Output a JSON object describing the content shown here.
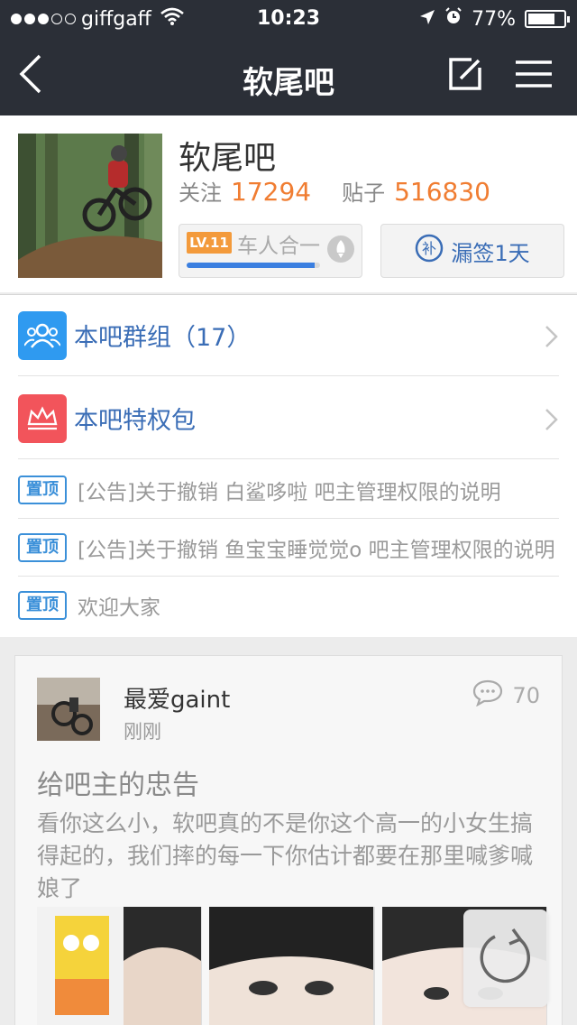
{
  "status_bar": {
    "carrier": "giffgaff",
    "time": "10:23",
    "battery": "77%",
    "battery_level": 0.77,
    "signal_bars_filled": 3,
    "signal_bars_total": 5
  },
  "nav": {
    "title": "软尾吧",
    "back_icon": "chevron-left-icon",
    "compose_icon": "compose-icon",
    "menu_icon": "hamburger-menu-icon"
  },
  "forum": {
    "name": "软尾吧",
    "follow_label": "关注",
    "follow_count": "17294",
    "posts_label": "贴子",
    "posts_count": "516830",
    "level_badge": "LV.11",
    "level_name": "车人合一",
    "level_progress": 0.96,
    "sign_button": "漏签1天",
    "sign_icon_text": "补"
  },
  "entries": [
    {
      "label": "本吧群组（17）",
      "icon": "group-icon",
      "color": "#2f9af0"
    },
    {
      "label": "本吧特权包",
      "icon": "crown-icon",
      "color": "#f2545b"
    }
  ],
  "pinned_tag": "置顶",
  "notices": [
    "[公告]关于撤销 白鲨哆啦 吧主管理权限的说明",
    "[公告]关于撤销 鱼宝宝睡觉觉o  吧主管理权限的说明",
    "欢迎大家"
  ],
  "post": {
    "author": "最爱gaint",
    "time": "刚刚",
    "reply_count": "70",
    "title": "给吧主的忠告",
    "body": "看你这么小，软吧真的不是你这个高一的小女生搞得起的，我们摔的每一下你估计都要在那里喊爹喊娘了"
  },
  "colors": {
    "nav_bg": "#2b2f37",
    "accent_orange": "#f07d32",
    "link_blue": "#3a6db6",
    "tag_blue": "#3b90d9"
  }
}
